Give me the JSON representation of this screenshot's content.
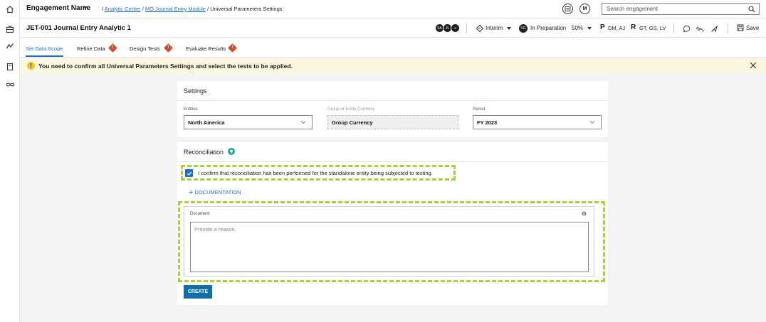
{
  "rail": {
    "icons": [
      "home-icon",
      "briefcase-icon",
      "analytics-icon",
      "book-icon",
      "infinity-icon"
    ]
  },
  "header": {
    "engagement_name": "Engagement Name",
    "breadcrumb": {
      "separator": "/",
      "items": [
        "Analytic Center",
        "MO Journal Entry Module",
        "Universal Parameters Settings"
      ]
    },
    "avatar_initial": "M",
    "search_placeholder": "Search engagement"
  },
  "subheader": {
    "title": "JET-001 Journal Entry Analytic 1",
    "team_avatars": [
      "SA",
      "JL",
      "∞"
    ],
    "phase": "Interim",
    "status_avatar": "SG",
    "status": "In Preparation",
    "progress": "50%",
    "preparer_letter": "P",
    "preparers": "DM, AJ",
    "reviewer_letter": "R",
    "reviewers": "GT, GS, LV",
    "save_label": "Save"
  },
  "tabs": [
    {
      "label": "Set Data Scope",
      "active": true,
      "warning": false
    },
    {
      "label": "Refine Data",
      "active": false,
      "warning": true
    },
    {
      "label": "Design Tests",
      "active": false,
      "warning": true
    },
    {
      "label": "Evaluate Results",
      "active": false,
      "warning": true
    }
  ],
  "banner": {
    "icon": "!",
    "message": "You need to confirm all Universal Parameters Settings and select the tests to be applied."
  },
  "settings": {
    "title": "Settings",
    "entities_label": "Entities",
    "entities_value": "North America",
    "currency_label": "Group or Entity Currency",
    "currency_value": "Group Currency",
    "period_label": "Period",
    "period_value": "FY 2023"
  },
  "reconciliation": {
    "title": "Reconciliation",
    "confirm_text": "I confirm that reconciliation has been performed for the standalone entity being subjected to testing.",
    "confirmed": true,
    "documentation_link": "DOCUMENTATION",
    "document_label": "Document",
    "document_placeholder": "Provide a reason.",
    "create_label": "CREATE"
  },
  "colors": {
    "accent": "#1a73c9",
    "warning": "#d94a2c",
    "banner_bg": "#fbf6df",
    "highlight": "#a7d13b",
    "primary_button": "#0f6fa6"
  }
}
